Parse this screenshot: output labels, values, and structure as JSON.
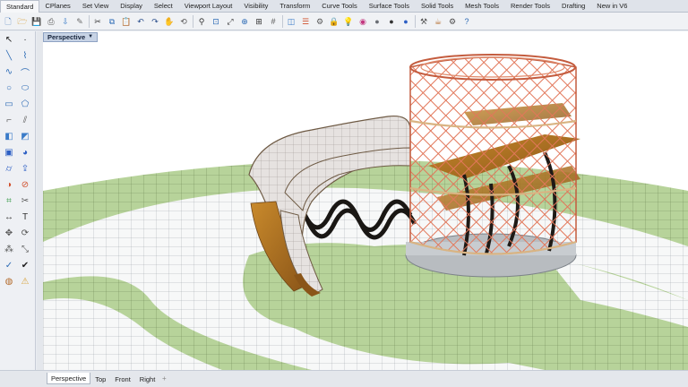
{
  "app": {
    "accent": "#c7d3e5"
  },
  "tabs": [
    {
      "label": "Standard",
      "active": true
    },
    {
      "label": "CPlanes"
    },
    {
      "label": "Set View"
    },
    {
      "label": "Display"
    },
    {
      "label": "Select"
    },
    {
      "label": "Viewport Layout"
    },
    {
      "label": "Visibility"
    },
    {
      "label": "Transform"
    },
    {
      "label": "Curve Tools"
    },
    {
      "label": "Surface Tools"
    },
    {
      "label": "Solid Tools"
    },
    {
      "label": "Mesh Tools"
    },
    {
      "label": "Render Tools"
    },
    {
      "label": "Drafting"
    },
    {
      "label": "New in V6"
    }
  ],
  "toolbar_icons": [
    "new-file",
    "open-folder",
    "save",
    "print",
    "import",
    "copy-properties",
    "sep",
    "cut",
    "copy",
    "paste",
    "undo",
    "redo",
    "pan-hand",
    "rotate-view",
    "sep",
    "zoom",
    "zoom-window",
    "zoom-extents",
    "zoom-selected",
    "four-viewports",
    "grid",
    "sep",
    "cplane",
    "layers",
    "properties",
    "lock",
    "light-bulb",
    "color-wheel",
    "sphere-shaded",
    "sphere-rendered",
    "sphere-blue",
    "sep",
    "tools",
    "render-teapot",
    "settings",
    "help"
  ],
  "sidebar_icons": [
    [
      "select-arrow",
      "point"
    ],
    [
      "line",
      "polyline"
    ],
    [
      "curve",
      "arc"
    ],
    [
      "circle",
      "ellipse"
    ],
    [
      "rectangle",
      "polygon"
    ],
    [
      "fillet",
      "offset"
    ],
    [
      "surface",
      "patch"
    ],
    [
      "box",
      "sphere"
    ],
    [
      "cylinder",
      "extrude"
    ],
    [
      "boolean",
      "split"
    ],
    [
      "mesh",
      "trim"
    ],
    [
      "dimension",
      "text"
    ],
    [
      "transform-move",
      "rotate"
    ],
    [
      "array",
      "scale"
    ],
    [
      "analyze",
      "check"
    ],
    [
      "render",
      "warning"
    ]
  ],
  "viewport": {
    "label": "Perspective"
  },
  "viewport_tabs": [
    {
      "label": "Perspective",
      "active": true
    },
    {
      "label": "Top"
    },
    {
      "label": "Front"
    },
    {
      "label": "Right"
    }
  ],
  "viewport_tab_add": "+"
}
